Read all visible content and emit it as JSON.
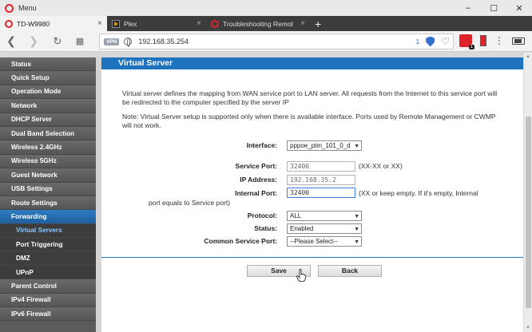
{
  "window": {
    "menu_label": "Menu",
    "controls": [
      "–",
      "☐",
      "✕"
    ]
  },
  "tabs": [
    {
      "label": "TD-W9980",
      "close": "×",
      "active": true
    },
    {
      "label": "Plex",
      "close": "×",
      "active": false
    },
    {
      "label": "Troubleshooting Remote A",
      "close": "×",
      "active": false
    }
  ],
  "tab_add": "+",
  "address": {
    "vpn": "VPN",
    "url": "192.168.35.254",
    "blocked_count": "1"
  },
  "extensions": {
    "badge": "1"
  },
  "sidebar": {
    "items": [
      {
        "label": "Status",
        "type": "main"
      },
      {
        "label": "Quick Setup",
        "type": "main"
      },
      {
        "label": "Operation Mode",
        "type": "main"
      },
      {
        "label": "Network",
        "type": "main"
      },
      {
        "label": "DHCP Server",
        "type": "main"
      },
      {
        "label": "Dual Band Selection",
        "type": "main"
      },
      {
        "label": "Wireless 2.4GHz",
        "type": "main"
      },
      {
        "label": "Wireless 5GHz",
        "type": "main"
      },
      {
        "label": "Guest Network",
        "type": "main"
      },
      {
        "label": "USB Settings",
        "type": "main"
      },
      {
        "label": "Route Settings",
        "type": "main"
      },
      {
        "label": "Forwarding",
        "type": "active"
      },
      {
        "label": "Virtual Servers",
        "type": "sub-active"
      },
      {
        "label": "Port Triggering",
        "type": "sub"
      },
      {
        "label": "DMZ",
        "type": "sub"
      },
      {
        "label": "UPnP",
        "type": "sub"
      },
      {
        "label": "Parent Control",
        "type": "main"
      },
      {
        "label": "IPv4 Firewall",
        "type": "main"
      },
      {
        "label": "IPv6 Firewall",
        "type": "main"
      }
    ]
  },
  "page": {
    "title": "Virtual Server",
    "description": "Virtual server defines the mapping from WAN service port to LAN server. All requests from the Internet to this service port will be redirected to the computer specified by the server IP",
    "note": "Note: Virtual Server setup is supported only when there is available interface. Ports used by Remote Management or CWMP will not work."
  },
  "form": {
    "interface_label": "Interface:",
    "interface_value": "pppoe_ptm_101_0_d",
    "service_port_label": "Service Port:",
    "service_port_value": "32400",
    "service_port_hint": "(XX-XX or XX)",
    "ip_label": "IP Address:",
    "ip_value": "192.168.35.2",
    "internal_port_label": "Internal Port:",
    "internal_port_value": "32400",
    "internal_port_hint_1": "(XX or keep empty. If it's empty, Internal",
    "internal_port_hint_2": "port equals to Service port)",
    "protocol_label": "Protocol:",
    "protocol_value": "ALL",
    "status_label": "Status:",
    "status_value": "Enabled",
    "common_port_label": "Common Service Port:",
    "common_port_value": "--Please Select--"
  },
  "buttons": {
    "save": "Save",
    "back": "Back"
  },
  "colors": {
    "accent": "#1e72be",
    "sidebar": "#5b5b5b",
    "opera_red": "#e0232a"
  }
}
